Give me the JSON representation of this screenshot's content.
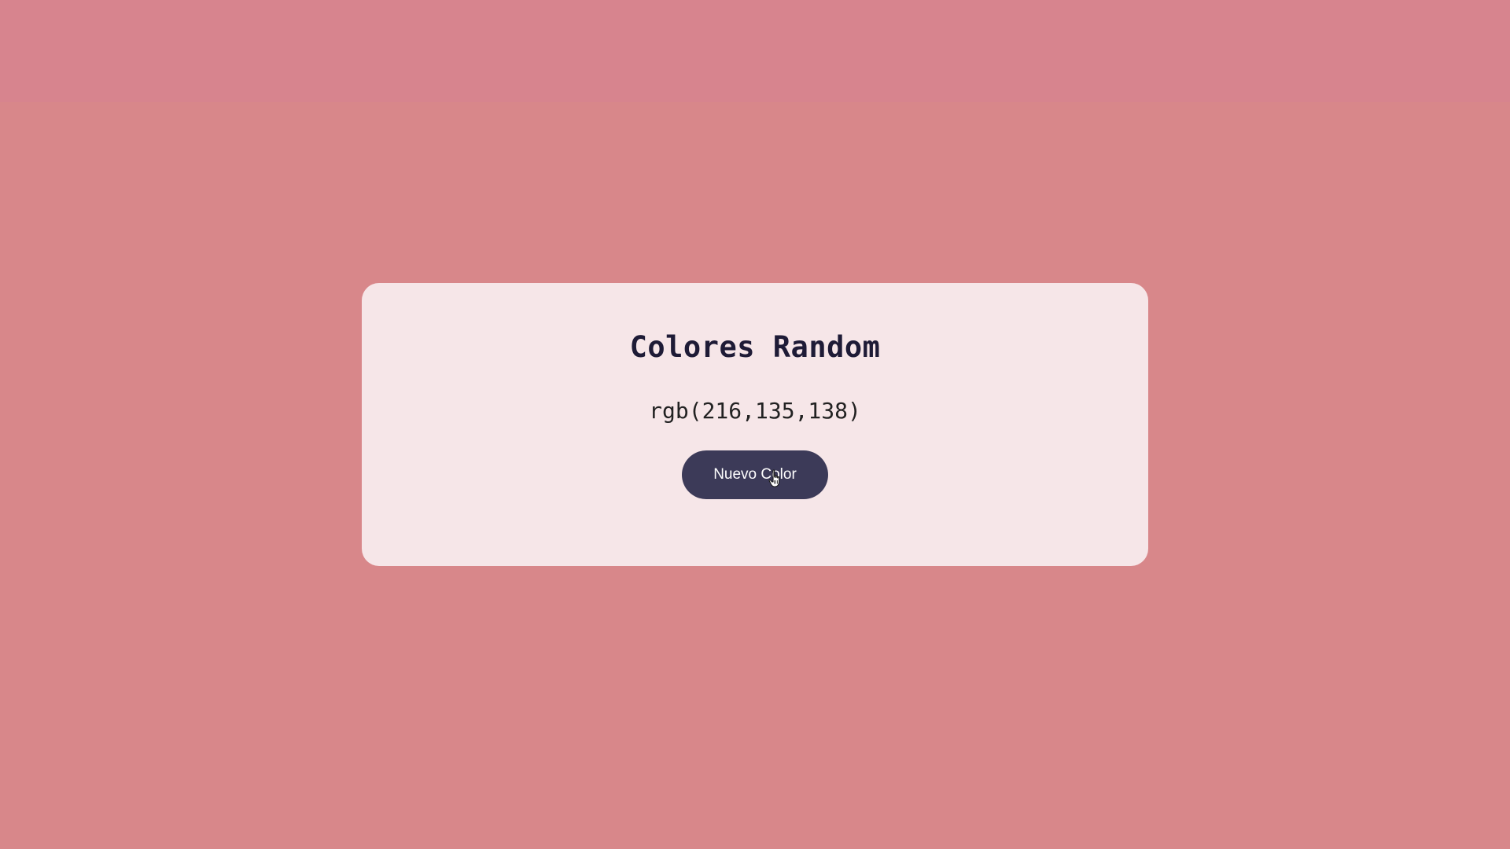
{
  "page": {
    "background_color": "#d8878a",
    "top_band_color": "#d7848e"
  },
  "card": {
    "title": "Colores Random",
    "color_value": "rgb(216,135,138)",
    "button_label": "Nuevo Color",
    "background_color": "#f6e6e8",
    "button_color": "#3c3a58"
  },
  "icons": {
    "cursor": "hand-pointer-icon"
  }
}
